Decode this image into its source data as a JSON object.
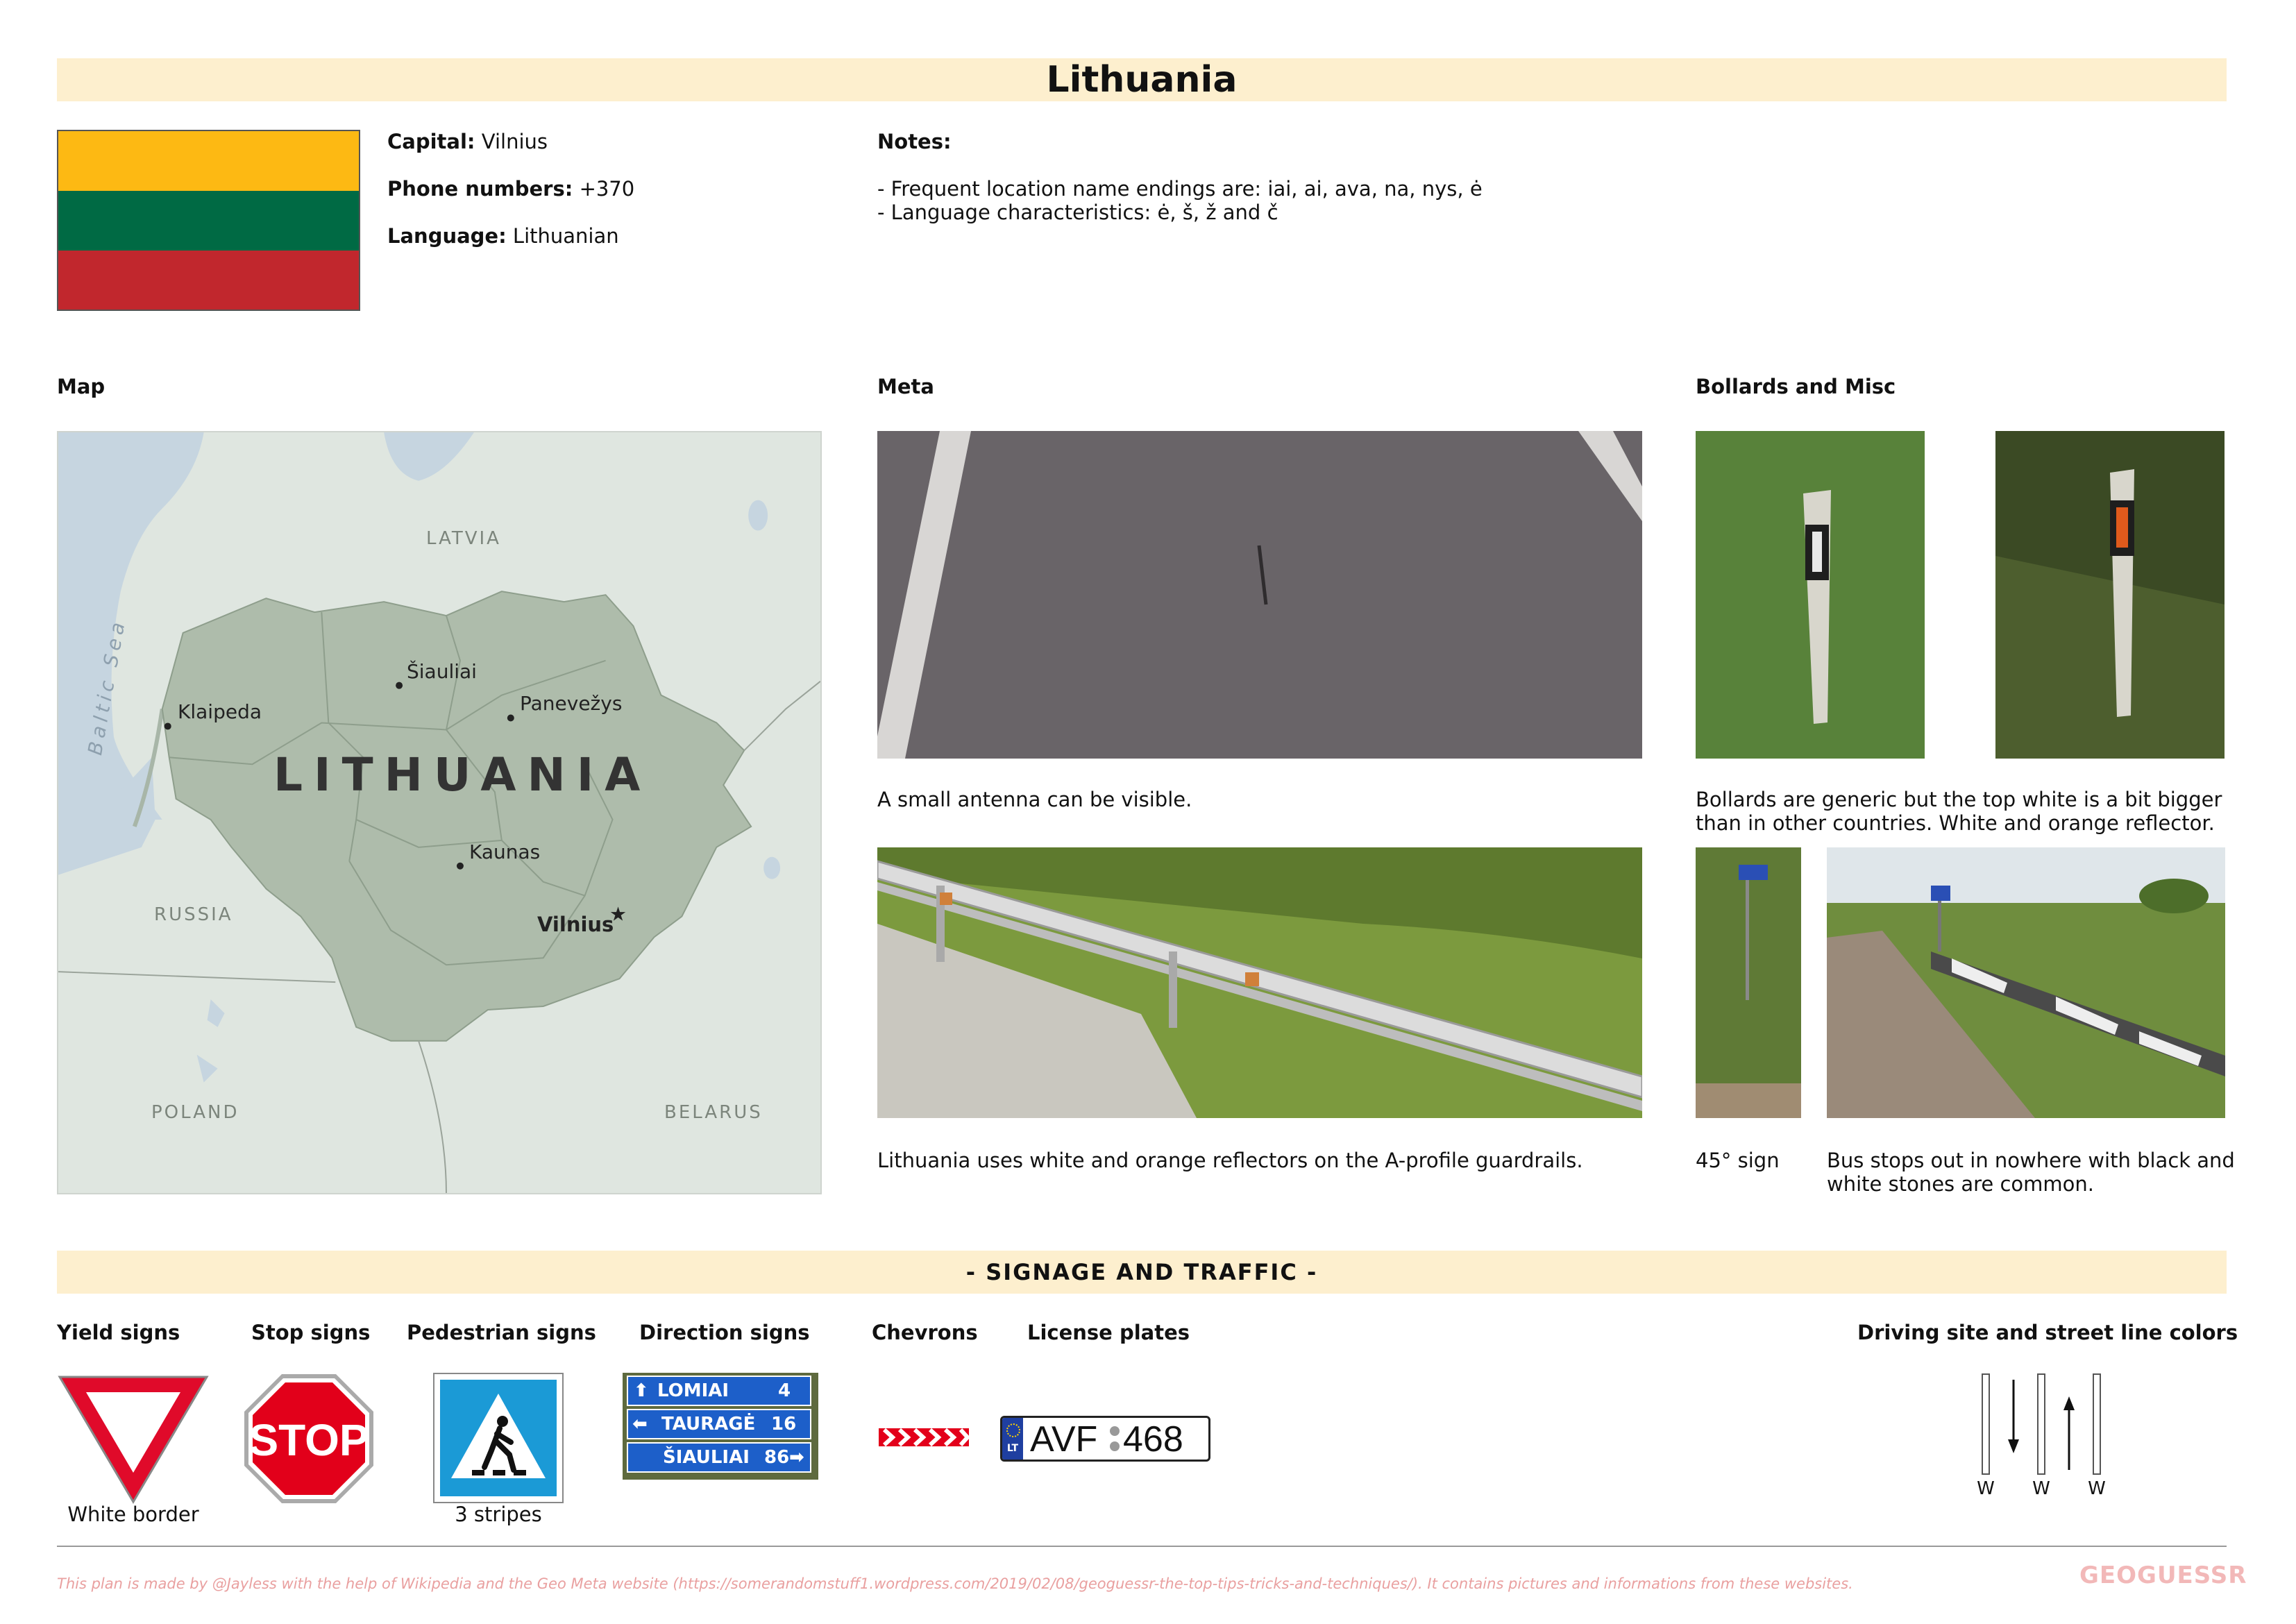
{
  "title": "Lithuania",
  "info": {
    "capital_label": "Capital:",
    "capital_value": "Vilnius",
    "phone_label": "Phone numbers:",
    "phone_value": "+370",
    "language_label": "Language:",
    "language_value": "Lithuanian"
  },
  "notes": {
    "label": "Notes:",
    "line1": "- Frequent location name endings are: iai, ai, ava, na, nys, ė",
    "line2": "- Language characteristics: ė, š, ž and č"
  },
  "flag": {
    "colors": [
      "#fdb913",
      "#006a44",
      "#c1272d"
    ]
  },
  "sections": {
    "map": "Map",
    "meta": "Meta",
    "bollards": "Bollards and Misc"
  },
  "map": {
    "country": "LITHUANIA",
    "neighbors": {
      "latvia": "LATVIA",
      "russia": "RUSSIA",
      "poland": "POLAND",
      "belarus": "BELARUS"
    },
    "sea": "Baltic Sea",
    "cities": {
      "siauliai": "Šiauliai",
      "klaipeda": "Klaipeda",
      "panevezys": "Panevežys",
      "kaunas": "Kaunas",
      "vilnius": "Vilnius"
    }
  },
  "meta": {
    "antenna_caption": "A small antenna can be visible.",
    "guardrail_caption": "Lithuania uses white and orange reflectors on the A-profile guardrails."
  },
  "bollards": {
    "caption_line1": "Bollards are generic but the top white is a bit bigger",
    "caption_line2": "than in other countries. White and orange reflector.",
    "sign45_caption": "45° sign",
    "busstop_line1": "Bus stops out in nowhere with black and",
    "busstop_line2": "white stones are common."
  },
  "signage": {
    "band_title": "- SIGNAGE AND TRAFFIC -",
    "yield": "Yield signs",
    "stop": "Stop signs",
    "pedestrian": "Pedestrian signs",
    "direction": "Direction signs",
    "chevrons": "Chevrons",
    "plates": "License plates",
    "driving": "Driving site and street line colors",
    "yield_caption": "White border",
    "ped_caption": "3 stripes",
    "stop_text": "STOP",
    "direction_rows": [
      {
        "place": "LOMIAI",
        "km": "4"
      },
      {
        "place": "TAURAGĖ",
        "km": "16"
      },
      {
        "place": "ŠIAULIAI",
        "km": "86"
      }
    ],
    "plate_country": "LT",
    "plate_left": "AVF",
    "plate_right": "468",
    "line_labels": [
      "W",
      "W",
      "W"
    ]
  },
  "footer": "This plan is made by @Jayless with the help of Wikipedia and the Geo Meta website (https://somerandomstuff1.wordpress.com/2019/02/08/geoguessr-the-top-tips-tricks-and-techniques/). It contains pictures and informations from these websites.",
  "logo": "GEOGUESSR"
}
